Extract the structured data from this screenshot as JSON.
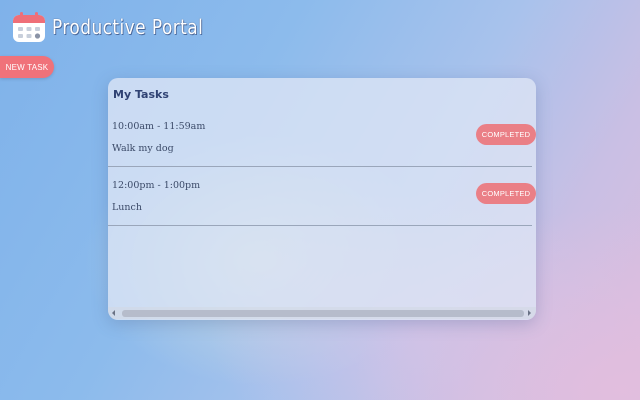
{
  "app": {
    "title": "Productive Portal",
    "logo_icon": "calendar-icon"
  },
  "toolbar": {
    "new_task_label": "NEW TASK"
  },
  "tasks_panel": {
    "title": "My Tasks",
    "tasks": [
      {
        "time": "10:00am - 11:59am",
        "name": "Walk my dog",
        "status_label": "COMPLETED"
      },
      {
        "time": "12:00pm - 1:00pm",
        "name": "Lunch",
        "status_label": "COMPLETED"
      }
    ]
  },
  "colors": {
    "accent_button": "#f0727a",
    "completed_button": "#ea7f86",
    "heading": "#2f4273",
    "text": "#3b4a68",
    "background_start": "#7fb2ea",
    "background_end": "#dcbedf"
  }
}
